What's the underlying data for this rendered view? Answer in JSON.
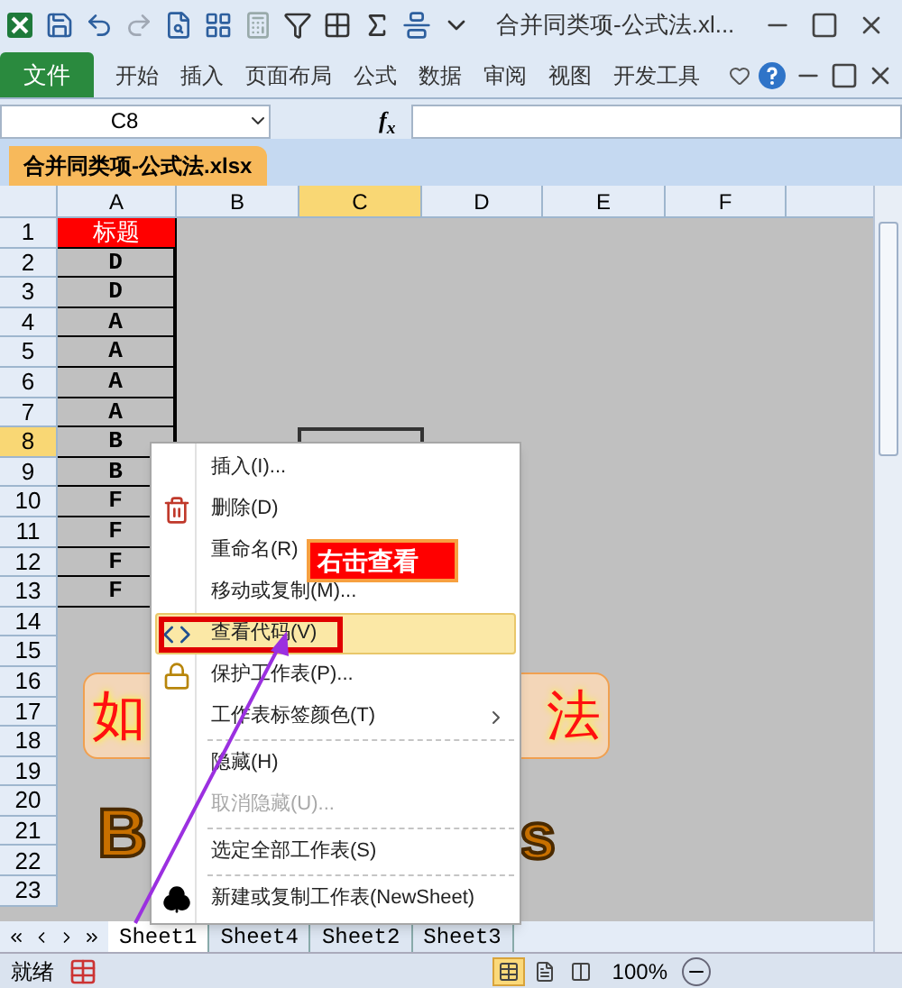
{
  "title_bar": {
    "title": "合并同类项-公式法.xl..."
  },
  "ribbon_tabs": [
    {
      "label": "文件",
      "kind": "file"
    },
    {
      "label": "开始",
      "kind": "tab"
    },
    {
      "label": "插入",
      "kind": "tab"
    },
    {
      "label": "页面布局",
      "kind": "tab"
    },
    {
      "label": "公式",
      "kind": "tab"
    },
    {
      "label": "数据",
      "kind": "tab"
    },
    {
      "label": "审阅",
      "kind": "tab"
    },
    {
      "label": "视图",
      "kind": "tab"
    },
    {
      "label": "开发工具",
      "kind": "tab"
    }
  ],
  "name_box": {
    "value": "C8"
  },
  "formula_bar": {
    "fx": "f$_{x}$"
  },
  "workbook_tab": {
    "label": "合并同类项-公式法.xlsx"
  },
  "columns": [
    {
      "label": "A",
      "selected": false
    },
    {
      "label": "B",
      "selected": false
    },
    {
      "label": "C",
      "selected": true
    },
    {
      "label": "D",
      "selected": false
    },
    {
      "label": "E",
      "selected": false
    },
    {
      "label": "F",
      "selected": false
    }
  ],
  "rows": [
    {
      "number": "1",
      "selected": false,
      "value": "标题",
      "kind": "title"
    },
    {
      "number": "2",
      "selected": false,
      "value": "D",
      "kind": "data"
    },
    {
      "number": "3",
      "selected": false,
      "value": "D",
      "kind": "data"
    },
    {
      "number": "4",
      "selected": false,
      "value": "A",
      "kind": "data"
    },
    {
      "number": "5",
      "selected": false,
      "value": "A",
      "kind": "data"
    },
    {
      "number": "6",
      "selected": false,
      "value": "A",
      "kind": "data"
    },
    {
      "number": "7",
      "selected": false,
      "value": "A",
      "kind": "data"
    },
    {
      "number": "8",
      "selected": true,
      "value": "B",
      "kind": "data"
    },
    {
      "number": "9",
      "selected": false,
      "value": "B",
      "kind": "data"
    },
    {
      "number": "10",
      "selected": false,
      "value": "F",
      "kind": "data"
    },
    {
      "number": "11",
      "selected": false,
      "value": "F",
      "kind": "data"
    },
    {
      "number": "12",
      "selected": false,
      "value": "F",
      "kind": "data"
    },
    {
      "number": "13",
      "selected": false,
      "value": "F",
      "kind": "data"
    },
    {
      "number": "14",
      "selected": false,
      "kind": "empty"
    },
    {
      "number": "15",
      "selected": false,
      "kind": "empty"
    },
    {
      "number": "16",
      "selected": false,
      "kind": "empty"
    },
    {
      "number": "17",
      "selected": false,
      "kind": "empty"
    },
    {
      "number": "18",
      "selected": false,
      "kind": "empty"
    },
    {
      "number": "19",
      "selected": false,
      "kind": "empty"
    },
    {
      "number": "20",
      "selected": false,
      "kind": "empty"
    },
    {
      "number": "21",
      "selected": false,
      "kind": "empty"
    },
    {
      "number": "22",
      "selected": false,
      "kind": "empty"
    },
    {
      "number": "23",
      "selected": false,
      "kind": "empty"
    }
  ],
  "banner": {
    "left": "如",
    "right": "法"
  },
  "word_art": {
    "left": "B",
    "right": "s"
  },
  "context_menu": {
    "items": [
      {
        "label": "插入(I)...",
        "kind": "plain",
        "disabled": false,
        "highlighted": false,
        "submenu": false,
        "separator_before": false
      },
      {
        "label": "删除(D)",
        "kind": "delete",
        "disabled": false,
        "highlighted": false,
        "submenu": false,
        "separator_before": false
      },
      {
        "label": "重命名(R)",
        "kind": "plain",
        "disabled": false,
        "highlighted": false,
        "submenu": false,
        "separator_before": false
      },
      {
        "label": "移动或复制(M)...",
        "kind": "plain",
        "disabled": false,
        "highlighted": false,
        "submenu": false,
        "separator_before": false
      },
      {
        "label": "查看代码(V)",
        "kind": "code",
        "disabled": false,
        "highlighted": true,
        "submenu": false,
        "separator_before": false
      },
      {
        "label": "保护工作表(P)...",
        "kind": "lock",
        "disabled": false,
        "highlighted": false,
        "submenu": false,
        "separator_before": false
      },
      {
        "label": "工作表标签颜色(T)",
        "kind": "plain",
        "disabled": false,
        "highlighted": false,
        "submenu": true,
        "separator_before": false
      },
      {
        "label": "隐藏(H)",
        "kind": "plain",
        "disabled": false,
        "highlighted": false,
        "submenu": false,
        "separator_before": true
      },
      {
        "label": "取消隐藏(U)...",
        "kind": "plain",
        "disabled": true,
        "highlighted": false,
        "submenu": false,
        "separator_before": false
      },
      {
        "label": "选定全部工作表(S)",
        "kind": "plain",
        "disabled": false,
        "highlighted": false,
        "submenu": false,
        "separator_before": true
      },
      {
        "label": "新建或复制工作表(NewSheet)",
        "kind": "club",
        "disabled": false,
        "highlighted": false,
        "submenu": false,
        "separator_before": true
      }
    ]
  },
  "callout": {
    "text": "右击查看"
  },
  "sheet_tabs": [
    {
      "label": "Sheet1",
      "selected": true
    },
    {
      "label": "Sheet4",
      "selected": false
    },
    {
      "label": "Sheet2",
      "selected": false
    },
    {
      "label": "Sheet3",
      "selected": false
    }
  ],
  "status_bar": {
    "status": "就绪",
    "views": [
      {
        "selected": true
      },
      {
        "selected": false
      },
      {
        "selected": false
      }
    ],
    "zoom": "100%"
  }
}
